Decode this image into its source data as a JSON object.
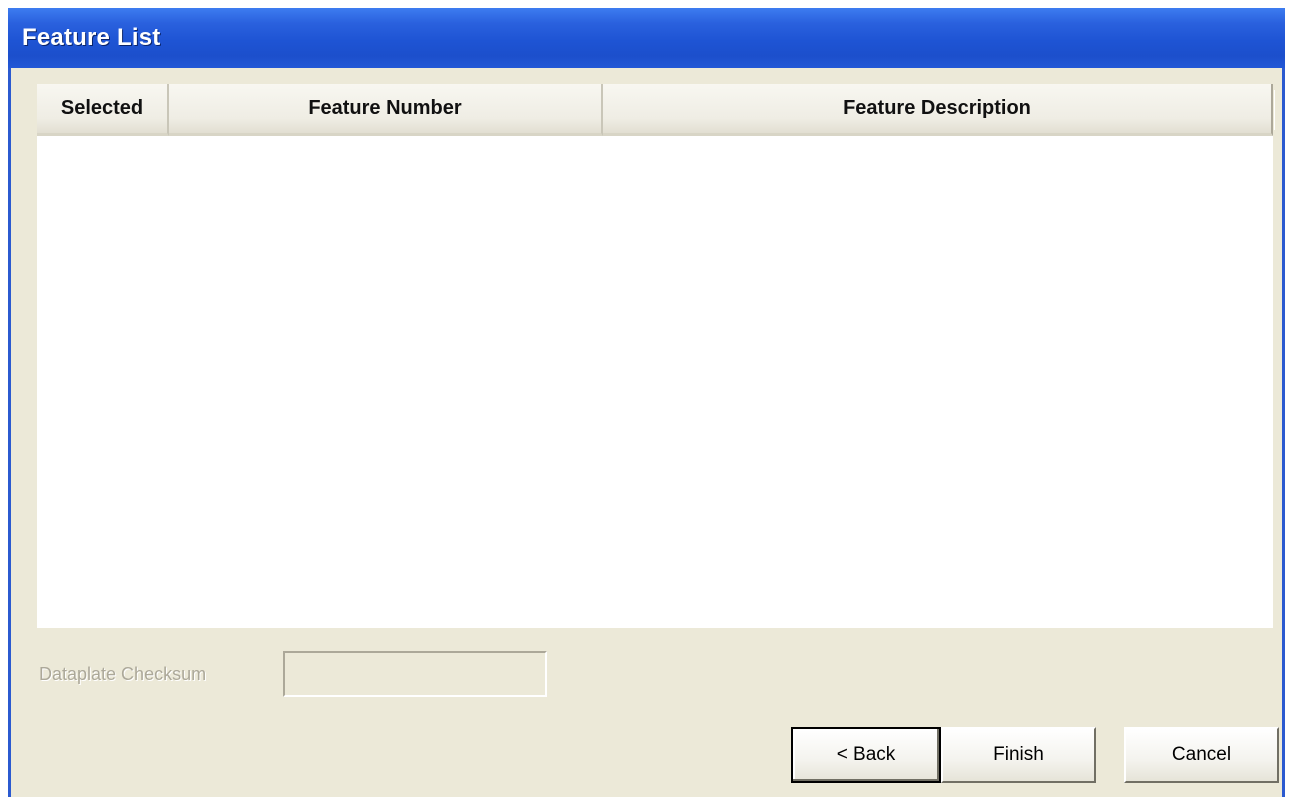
{
  "window": {
    "title": "Feature List"
  },
  "feature_list": {
    "columns": [
      {
        "label": "Selected"
      },
      {
        "label": "Feature Number"
      },
      {
        "label": "Feature Description"
      }
    ],
    "rows": []
  },
  "checksum": {
    "label": "Dataplate Checksum",
    "value": ""
  },
  "buttons": {
    "back": "< Back",
    "finish": "Finish",
    "cancel": "Cancel"
  },
  "colors": {
    "titlebar": "#2257d6",
    "dialog_background": "#ece9d8",
    "list_background": "#ffffff"
  }
}
